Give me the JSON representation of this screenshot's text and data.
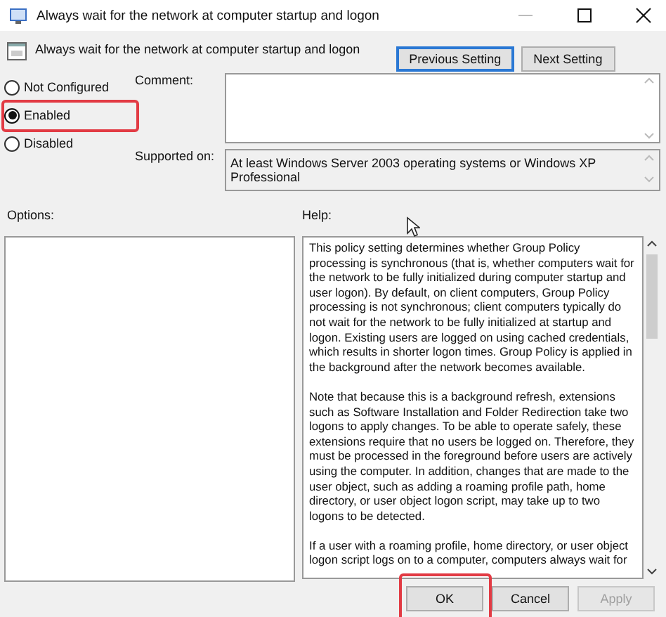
{
  "window": {
    "title": "Always wait for the network at computer startup and logon"
  },
  "policy_name": "Always wait for the network at computer startup and logon",
  "nav_buttons": [
    {
      "label": "Previous Setting",
      "focused": true
    },
    {
      "label": "Next Setting",
      "focused": false
    }
  ],
  "state_options": [
    {
      "label": "Not Configured",
      "selected": false,
      "highlighted": false
    },
    {
      "label": "Enabled",
      "selected": true,
      "highlighted": true
    },
    {
      "label": "Disabled",
      "selected": false,
      "highlighted": false
    }
  ],
  "comment": {
    "label": "Comment:"
  },
  "supported_on": {
    "label": "Supported on:",
    "value": "At least Windows Server 2003 operating systems or Windows XP Professional"
  },
  "options": {
    "label": "Options:"
  },
  "help": {
    "label": "Help:",
    "paragraphs": [
      "This policy setting determines whether Group Policy processing is synchronous (that is, whether computers wait for the network to be fully initialized during computer startup and user logon). By default, on client computers, Group Policy processing is not synchronous; client computers typically do not wait for the network to be fully initialized at startup and logon. Existing users are logged on using cached credentials, which results in shorter logon times. Group Policy is applied in the background after the network becomes available.",
      "Note that because this is a background refresh, extensions such as Software Installation and Folder Redirection take two logons to apply changes. To be able to operate safely, these extensions require that no users be logged on. Therefore, they must be processed in the foreground before users are actively using the computer. In addition, changes that are made to the user object, such as adding a roaming profile path, home directory, or user object logon script, may take up to two logons to be detected.",
      "If a user with a roaming profile, home directory, or user object logon script logs on to a computer, computers always wait for"
    ]
  },
  "dialog_buttons": [
    {
      "label": "OK",
      "disabled": false,
      "highlighted": true
    },
    {
      "label": "Cancel",
      "disabled": false,
      "highlighted": false
    },
    {
      "label": "Apply",
      "disabled": true,
      "highlighted": false
    }
  ]
}
